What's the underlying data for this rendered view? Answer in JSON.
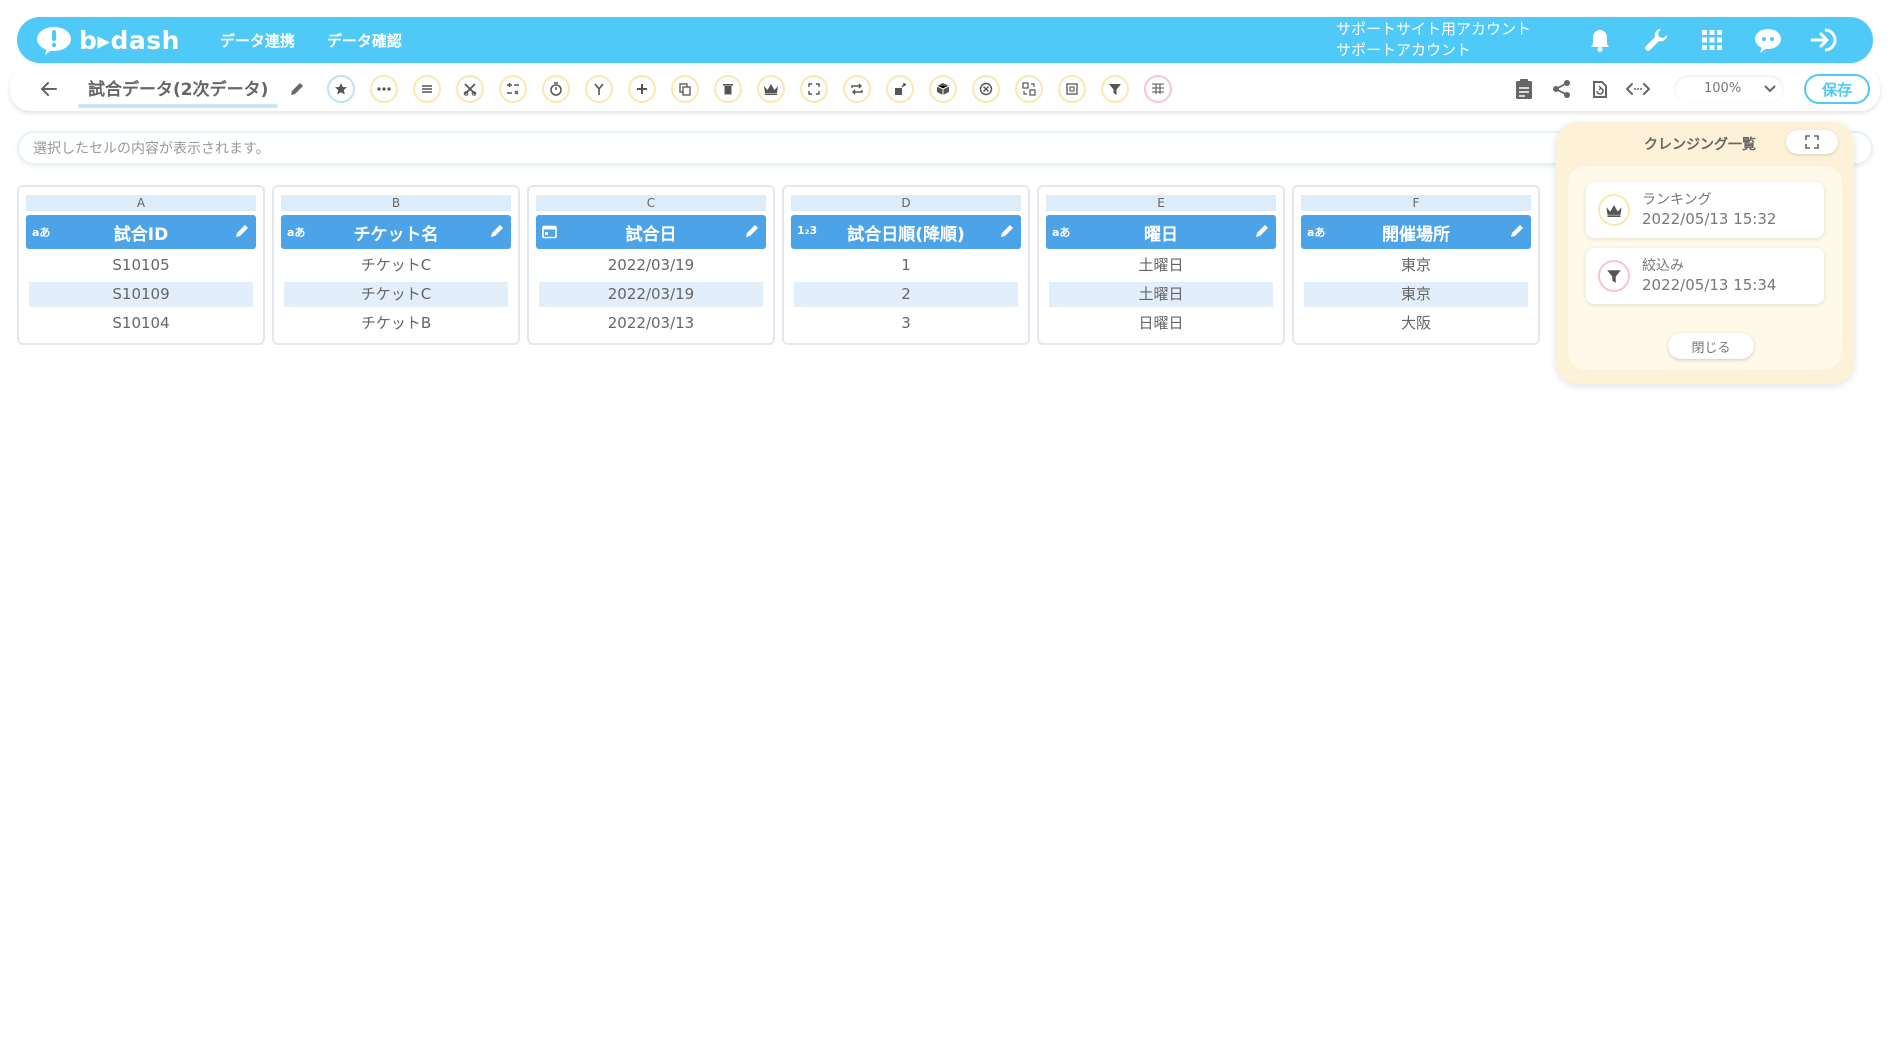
{
  "header": {
    "brand": "b▸dash",
    "nav": [
      {
        "label": "データ連携"
      },
      {
        "label": "データ確認"
      }
    ],
    "account_line1": "サポートサイト用アカウント",
    "account_line2": "サポートアカウント",
    "icons": [
      "bell-icon",
      "wrench-icon",
      "grid-apps-icon",
      "chat-bot-icon",
      "logout-icon"
    ]
  },
  "toolbar": {
    "title": "試合データ(2次データ)",
    "zoom": "100%",
    "save_label": "保存",
    "tool_icons": [
      "star-icon",
      "more-icon",
      "list-icon",
      "scissors-icon",
      "transform-icon",
      "timer-icon",
      "merge-icon",
      "add-icon",
      "copy-icon",
      "delete-icon",
      "crown-icon",
      "expand-icon",
      "repeat-icon",
      "lock-icon",
      "package-icon",
      "close-circle-icon",
      "replace-icon",
      "frame-icon",
      "filter-icon",
      "pivot-icon"
    ],
    "right_icons": [
      "clipboard-icon",
      "share-icon",
      "refresh-icon",
      "code-icon"
    ]
  },
  "cellbar": {
    "placeholder": "選択したセルの内容が表示されます。"
  },
  "grid": {
    "columns": [
      {
        "letter": "A",
        "name": "試合ID",
        "type": "aあ",
        "cells": [
          "S10105",
          "S10109",
          "S10104"
        ]
      },
      {
        "letter": "B",
        "name": "チケット名",
        "type": "aあ",
        "cells": [
          "チケットC",
          "チケットC",
          "チケットB"
        ]
      },
      {
        "letter": "C",
        "name": "試合日",
        "type": "calendar",
        "cells": [
          "2022/03/19",
          "2022/03/19",
          "2022/03/13"
        ]
      },
      {
        "letter": "D",
        "name": "試合日順(降順)",
        "type": "1₂3",
        "cells": [
          "1",
          "2",
          "3"
        ]
      },
      {
        "letter": "E",
        "name": "曜日",
        "type": "aあ",
        "cells": [
          "土曜日",
          "土曜日",
          "日曜日"
        ]
      },
      {
        "letter": "F",
        "name": "開催場所",
        "type": "aあ",
        "cells": [
          "東京",
          "東京",
          "大阪"
        ]
      }
    ]
  },
  "panel": {
    "title": "クレンジング一覧",
    "history": [
      {
        "name": "ランキング",
        "time": "2022/05/13 15:32",
        "icon": "crown-icon"
      },
      {
        "name": "絞込み",
        "time": "2022/05/13 15:34",
        "icon": "filter-icon"
      }
    ],
    "close_label": "閉じる"
  },
  "colors": {
    "brand": "#4fc9f7",
    "header_cell": "#4ca3e8",
    "panel_bg": "#fdf2d7"
  }
}
